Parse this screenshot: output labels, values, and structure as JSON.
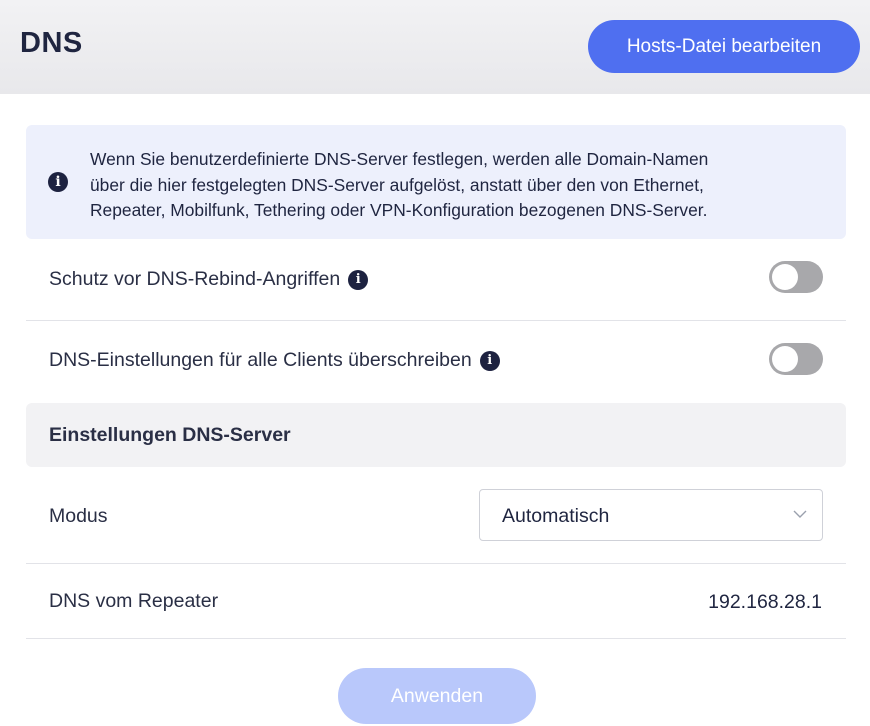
{
  "header": {
    "title": "DNS",
    "hosts_button": "Hosts-Datei bearbeiten"
  },
  "info": {
    "icon": "info-icon",
    "line1": "Wenn Sie benutzerdefinierte DNS-Server festlegen, werden alle Domain-Namen",
    "line2": "über die hier festgelegten DNS-Server aufgelöst, anstatt über den von Ethernet,",
    "line3": "Repeater, Mobilfunk, Tethering oder VPN-Konfiguration bezogenen DNS-Server."
  },
  "settings": {
    "rebind_label": "Schutz vor DNS-Rebind-Angriffen",
    "rebind_enabled": false,
    "override_label": "DNS-Einstellungen für alle Clients überschreiben",
    "override_enabled": false
  },
  "dns_server": {
    "section_title": "Einstellungen DNS-Server",
    "mode_label": "Modus",
    "mode_value": "Automatisch",
    "repeater_label": "DNS vom Repeater",
    "repeater_value": "192.168.28.1"
  },
  "footer": {
    "apply_button": "Anwenden"
  },
  "colors": {
    "accent": "#4f6ff0",
    "accent_disabled": "#b9c8fb",
    "info_bg": "#edf0fc",
    "toggle_off": "#a8a8ab"
  }
}
